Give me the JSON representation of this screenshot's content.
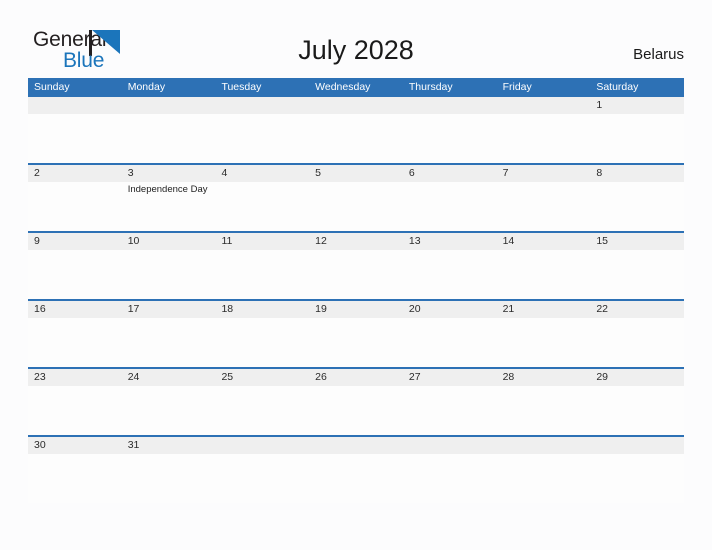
{
  "brand": {
    "name_part1": "General",
    "name_part2": "Blue",
    "triangle_icon": "triangle-flag-icon",
    "color_dark": "#231f20",
    "color_blue": "#1b75bb"
  },
  "header": {
    "title": "July 2028",
    "country": "Belarus"
  },
  "theme": {
    "header_blue": "#2d71b5",
    "number_band_gray": "#efefef",
    "page_background": "#fcfcfd",
    "text_dark": "#1a1a1a"
  },
  "calendar": {
    "month": "July",
    "year": "2028",
    "weekdays": [
      "Sunday",
      "Monday",
      "Tuesday",
      "Wednesday",
      "Thursday",
      "Friday",
      "Saturday"
    ],
    "weeks": [
      {
        "days": [
          {
            "number": "",
            "events": []
          },
          {
            "number": "",
            "events": []
          },
          {
            "number": "",
            "events": []
          },
          {
            "number": "",
            "events": []
          },
          {
            "number": "",
            "events": []
          },
          {
            "number": "",
            "events": []
          },
          {
            "number": "1",
            "events": []
          }
        ]
      },
      {
        "days": [
          {
            "number": "2",
            "events": []
          },
          {
            "number": "3",
            "events": [
              "Independence Day"
            ]
          },
          {
            "number": "4",
            "events": []
          },
          {
            "number": "5",
            "events": []
          },
          {
            "number": "6",
            "events": []
          },
          {
            "number": "7",
            "events": []
          },
          {
            "number": "8",
            "events": []
          }
        ]
      },
      {
        "days": [
          {
            "number": "9",
            "events": []
          },
          {
            "number": "10",
            "events": []
          },
          {
            "number": "11",
            "events": []
          },
          {
            "number": "12",
            "events": []
          },
          {
            "number": "13",
            "events": []
          },
          {
            "number": "14",
            "events": []
          },
          {
            "number": "15",
            "events": []
          }
        ]
      },
      {
        "days": [
          {
            "number": "16",
            "events": []
          },
          {
            "number": "17",
            "events": []
          },
          {
            "number": "18",
            "events": []
          },
          {
            "number": "19",
            "events": []
          },
          {
            "number": "20",
            "events": []
          },
          {
            "number": "21",
            "events": []
          },
          {
            "number": "22",
            "events": []
          }
        ]
      },
      {
        "days": [
          {
            "number": "23",
            "events": []
          },
          {
            "number": "24",
            "events": []
          },
          {
            "number": "25",
            "events": []
          },
          {
            "number": "26",
            "events": []
          },
          {
            "number": "27",
            "events": []
          },
          {
            "number": "28",
            "events": []
          },
          {
            "number": "29",
            "events": []
          }
        ]
      },
      {
        "days": [
          {
            "number": "30",
            "events": []
          },
          {
            "number": "31",
            "events": []
          },
          {
            "number": "",
            "events": []
          },
          {
            "number": "",
            "events": []
          },
          {
            "number": "",
            "events": []
          },
          {
            "number": "",
            "events": []
          },
          {
            "number": "",
            "events": []
          }
        ]
      }
    ]
  }
}
